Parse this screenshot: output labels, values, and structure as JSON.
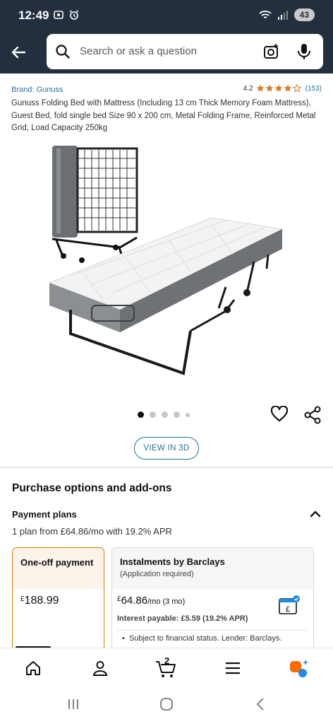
{
  "status_bar": {
    "time": "12:49",
    "battery": "43"
  },
  "search": {
    "placeholder": "Search or ask a question",
    "back_icon": "back-arrow-icon",
    "search_icon": "search-icon",
    "camera_icon": "camera-scan-icon",
    "mic_icon": "microphone-icon"
  },
  "product": {
    "brand": "Brand: Gunuss",
    "rating": "4.2",
    "rating_count": "(153)",
    "stars": 4.2,
    "title": "Gunuss Folding Bed with Mattress (Including 13 cm Thick Memory Foam Mattress), Guest Bed, fold single bed Size 90 x 200 cm, Metal Folding Frame, Reinforced Metal Grid, Load Capacity 250kg",
    "image_count": 5,
    "active_image": 1,
    "view_3d_label": "VIEW IN 3D"
  },
  "purchase": {
    "section_title": "Purchase options and add-ons",
    "plans_title": "Payment plans",
    "plans_subtitle": "1 plan from £64.86/mo with 19.2% APR",
    "one_off": {
      "title": "One-off payment",
      "currency": "£",
      "price": "188.99"
    },
    "barclays": {
      "title": "Instalments by Barclays",
      "note": "(Application required)",
      "currency": "£",
      "price": "64.86",
      "per": "/mo (3 mo)",
      "interest": "Interest payable: £5.59 (19.2% APR)",
      "bullet": "Subject to financial status. Lender: Barclays."
    }
  },
  "bottom_nav": {
    "cart_count": "2"
  },
  "colors": {
    "header_bg": "#232f3e",
    "star": "#de7921",
    "link": "#2a6f9a",
    "selected_border": "#e77600",
    "alexa_orange": "#ff6a00",
    "alexa_blue": "#1d8ae8"
  }
}
